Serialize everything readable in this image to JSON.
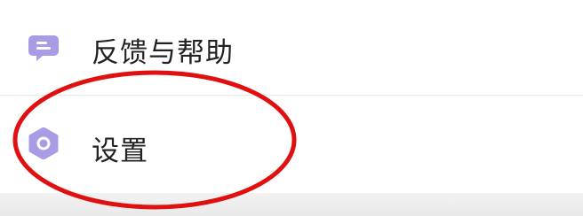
{
  "menu": {
    "items": [
      {
        "label": "反馈与帮助",
        "icon": "chat-bubble-icon"
      },
      {
        "label": "设置",
        "icon": "gear-icon"
      }
    ]
  },
  "colors": {
    "icon_purple": "#a99ce4",
    "annotation_red": "#e01010",
    "text": "#222222"
  }
}
